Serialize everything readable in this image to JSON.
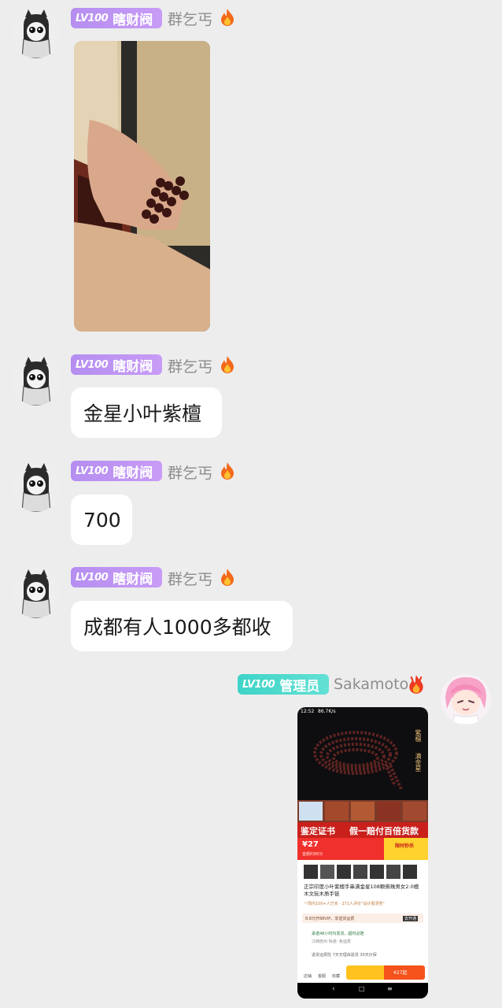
{
  "messages": [
    {
      "sender": {
        "level": "LV100",
        "group_title": "瞎财阀",
        "nickname": "群乞丐",
        "badge_icon": "fire-icon"
      },
      "type": "image"
    },
    {
      "sender": {
        "level": "LV100",
        "group_title": "瞎财阀",
        "nickname": "群乞丐",
        "badge_icon": "fire-icon"
      },
      "type": "text",
      "text": "金星小叶紫檀"
    },
    {
      "sender": {
        "level": "LV100",
        "group_title": "瞎财阀",
        "nickname": "群乞丐",
        "badge_icon": "fire-icon"
      },
      "type": "text",
      "text": "700"
    },
    {
      "sender": {
        "level": "LV100",
        "group_title": "瞎财阀",
        "nickname": "群乞丐",
        "badge_icon": "fire-icon"
      },
      "type": "text",
      "text": "成都有人1000多都收"
    },
    {
      "sender": {
        "level": "LV100",
        "group_title": "管理员",
        "nickname": "Sakamoto",
        "badge_icon": "fire-icon"
      },
      "type": "image",
      "screenshot": {
        "status_time": "12:52",
        "status_speed": "86.7K/s",
        "side_text_1": "紫檀",
        "side_text_2": "满金星",
        "banner_left": "鉴定证书",
        "banner_right": "假一赔付百倍货款",
        "price": "¥27",
        "price_sub": "金额约86分",
        "promo_label": "限时秒杀",
        "product_title": "正宗印度小叶紫檀手串满金星108颗佛珠男女2.0檀木文玩木质手链",
        "product_sub": "一周内100+人已买 · 271人评价\"设计很漂亮\"",
        "vip_text": "8.8元开88VIP，享送货运费",
        "vip_btn": "去开通",
        "service_text": "承诺48小时内发货，超时必赔",
        "location_text": "江西抚州  快递: 免运费",
        "guarantee_text": "退货运费险   7天无理由退货   30天价保",
        "buy_price": "¥27起",
        "nav_1": "店铺",
        "nav_2": "客服",
        "nav_3": "收藏"
      }
    }
  ],
  "colors": {
    "background": "#ededed",
    "bubble": "#ffffff",
    "badge_member": "#c08ff5",
    "badge_admin": "#4dd9cc",
    "name_gray": "#8d8d8d"
  }
}
